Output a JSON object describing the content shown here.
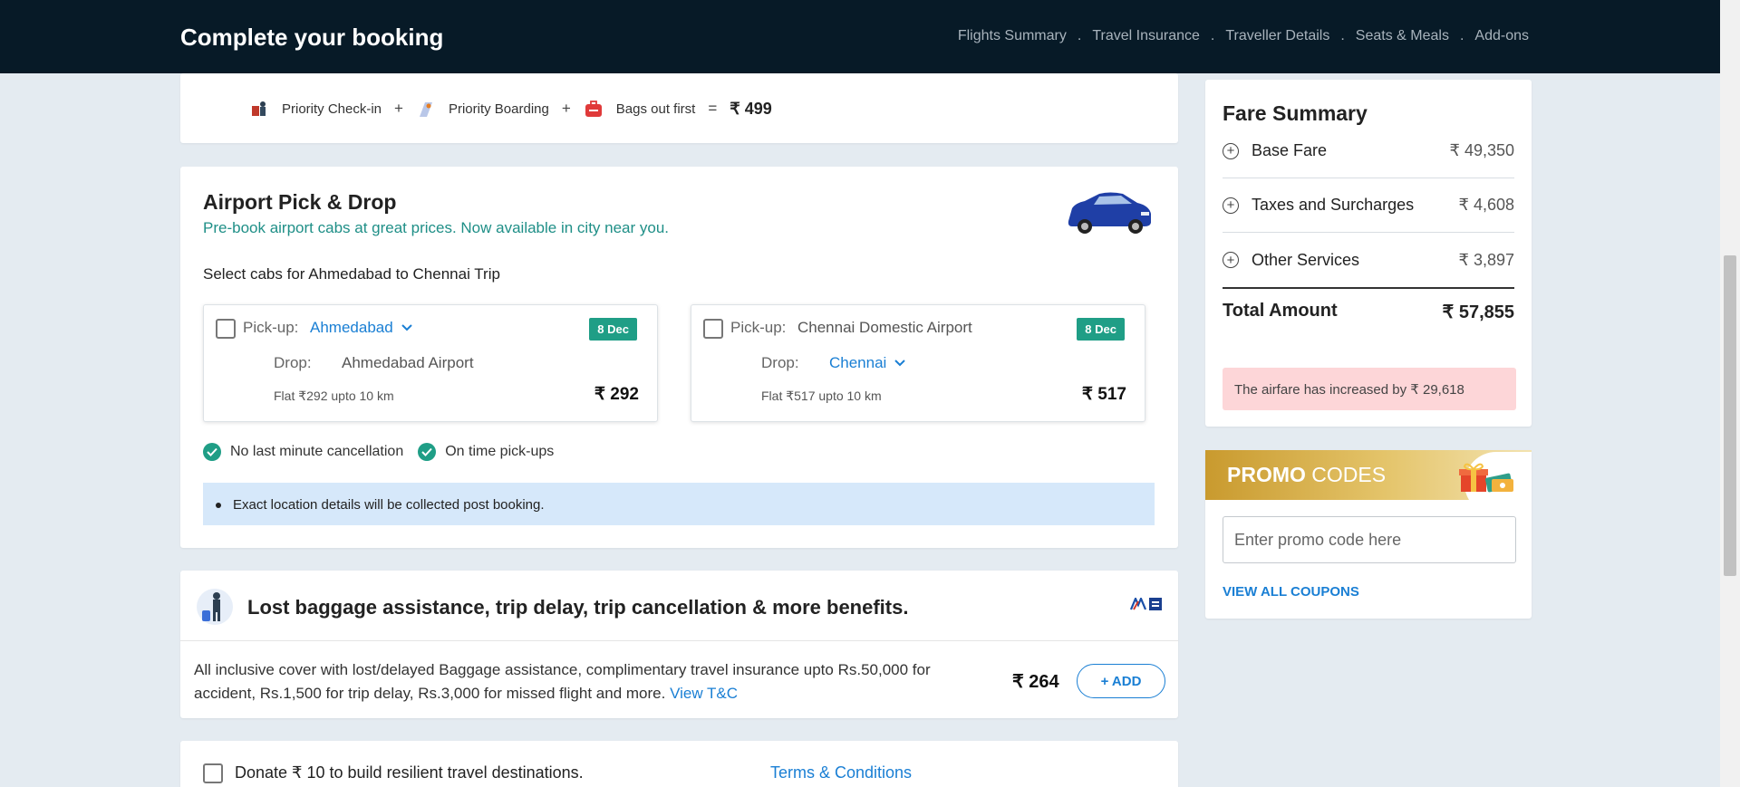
{
  "header": {
    "title": "Complete your booking",
    "steps": [
      "Flights Summary",
      "Travel Insurance",
      "Traveller Details",
      "Seats & Meals",
      "Add-ons"
    ]
  },
  "priority": {
    "items": [
      "Priority Check-in",
      "Priority Boarding",
      "Bags out first"
    ],
    "plus": "+",
    "equals": "=",
    "price": "₹ 499"
  },
  "airport": {
    "title": "Airport Pick & Drop",
    "subtitle": "Pre-book airport cabs at great prices. Now available in city near you.",
    "select_label": "Select cabs for Ahmedabad to Chennai Trip",
    "cab1": {
      "pickup_label": "Pick-up:",
      "pickup_value": "Ahmedabad",
      "drop_label": "Drop:",
      "drop_value": "Ahmedabad Airport",
      "date": "8 Dec",
      "flat": "Flat ₹292 upto 10 km",
      "price": "₹ 292"
    },
    "cab2": {
      "pickup_label": "Pick-up:",
      "pickup_value": "Chennai Domestic Airport",
      "drop_label": "Drop:",
      "drop_value": "Chennai",
      "date": "8 Dec",
      "flat": "Flat ₹517 upto 10 km",
      "price": "₹ 517"
    },
    "perks": [
      "No last minute cancellation",
      "On time pick-ups"
    ],
    "note": "Exact location details will be collected post booking."
  },
  "insurance": {
    "title": "Lost baggage assistance, trip delay, trip cancellation & more benefits.",
    "description": "All inclusive cover with lost/delayed Baggage assistance, complimentary travel insurance upto Rs.50,000 for accident, Rs.1,500 for trip delay, Rs.3,000 for missed flight and more.",
    "tc_link": "View T&C",
    "price": "₹ 264",
    "add_label": "+ ADD"
  },
  "donate": {
    "text": "Donate ₹ 10 to build resilient travel destinations.",
    "tc_link": "Terms & Conditions"
  },
  "fare_summary": {
    "title": "Fare Summary",
    "rows": [
      {
        "name": "Base Fare",
        "value": "₹ 49,350"
      },
      {
        "name": "Taxes and Surcharges",
        "value": "₹ 4,608"
      },
      {
        "name": "Other Services",
        "value": "₹ 3,897"
      }
    ],
    "total_label": "Total Amount",
    "total_value": "₹ 57,855",
    "alert": "The airfare has increased by ₹ 29,618"
  },
  "promo": {
    "title_bold": "PROMO",
    "title_rest": " CODES",
    "placeholder": "Enter promo code here",
    "view_all": "VIEW ALL COUPONS"
  },
  "colors": {
    "header_bg": "#071a27",
    "accent_blue": "#1a7fd4",
    "teal": "#1f9e86",
    "alert_bg": "#fdd6d8",
    "note_bg": "#d6e8fa"
  }
}
